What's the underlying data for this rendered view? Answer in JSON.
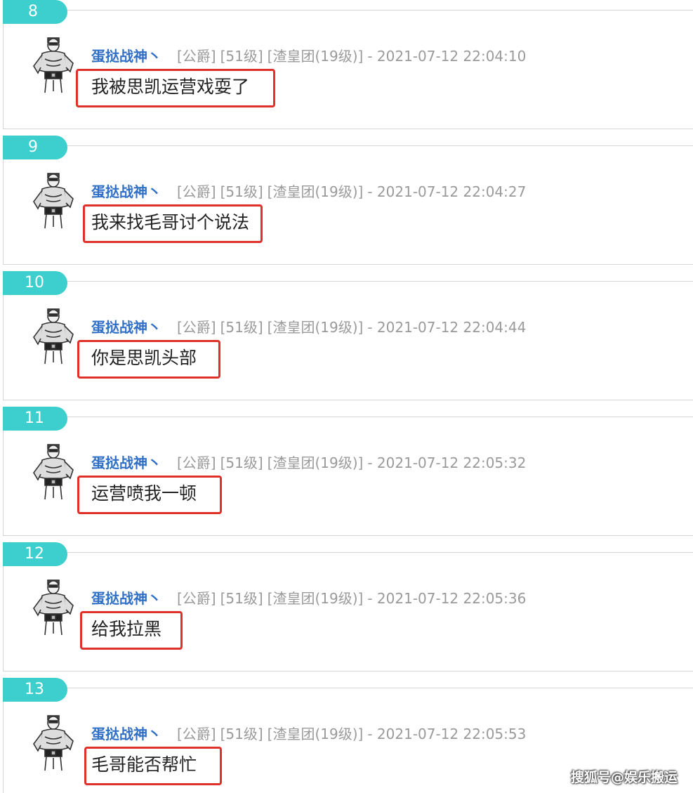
{
  "posts": [
    {
      "floor": "8",
      "user": "蛋挞战神丶",
      "rank": "[公爵]",
      "level": "[51级]",
      "group": "[渣皇团(19级)]",
      "time": "- 2021-07-12 22:04:10",
      "content": "我被思凯运营戏耍了"
    },
    {
      "floor": "9",
      "user": "蛋挞战神丶",
      "rank": "[公爵]",
      "level": "[51级]",
      "group": "[渣皇团(19级)]",
      "time": "- 2021-07-12 22:04:27",
      "content": "我来找毛哥讨个说法"
    },
    {
      "floor": "10",
      "user": "蛋挞战神丶",
      "rank": "[公爵]",
      "level": "[51级]",
      "group": "[渣皇团(19级)]",
      "time": "- 2021-07-12 22:04:44",
      "content": "你是思凯头部"
    },
    {
      "floor": "11",
      "user": "蛋挞战神丶",
      "rank": "[公爵]",
      "level": "[51级]",
      "group": "[渣皇团(19级)]",
      "time": "- 2021-07-12 22:05:32",
      "content": "运营喷我一顿"
    },
    {
      "floor": "12",
      "user": "蛋挞战神丶",
      "rank": "[公爵]",
      "level": "[51级]",
      "group": "[渣皇团(19级)]",
      "time": "- 2021-07-12 22:05:36",
      "content": "给我拉黑"
    },
    {
      "floor": "13",
      "user": "蛋挞战神丶",
      "rank": "[公爵]",
      "level": "[51级]",
      "group": "[渣皇团(19级)]",
      "time": "- 2021-07-12 22:05:53",
      "content": "毛哥能否帮忙"
    }
  ],
  "watermark": "搜狐号@娱乐搬运",
  "colors": {
    "floor_tab": "#3ccfcd",
    "username": "#2f6fc7",
    "highlight_box": "#e0302a",
    "meta_text": "#9a9a9a"
  },
  "icons": {
    "avatar": "avatar-icon"
  }
}
